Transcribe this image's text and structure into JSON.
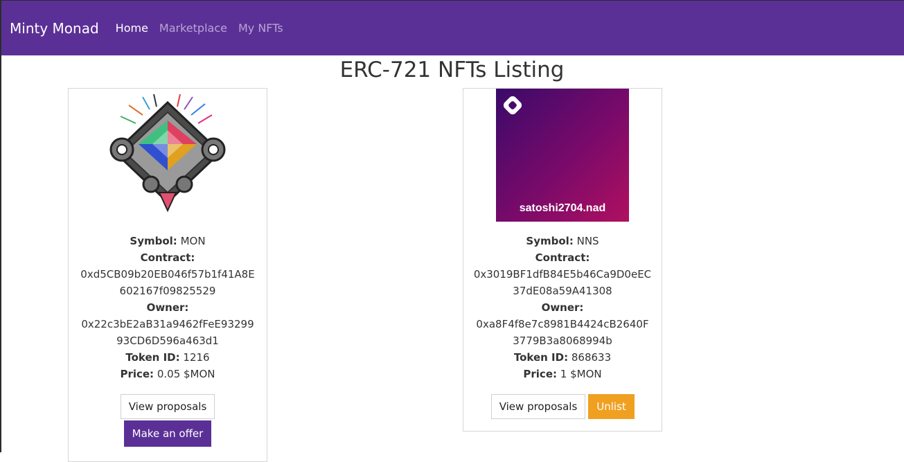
{
  "nav": {
    "brand": "Minty Monad",
    "links": [
      "Home",
      "Marketplace",
      "My NFTs"
    ]
  },
  "page_title": "ERC-721 NFTs Listing",
  "labels": {
    "symbol": "Symbol:",
    "contract": "Contract:",
    "owner": "Owner:",
    "token_id": "Token ID:",
    "price": "Price:"
  },
  "cards": [
    {
      "symbol": "MON",
      "contract": "0xd5CB09b20EB046f57b1f41A8E602167f09825529",
      "owner": "0x22c3bE2aB31a9462fFeE9329993CD6D596a463d1",
      "token_id": "1216",
      "price": "0.05 $MON",
      "buttons": [
        "View proposals",
        "Make an offer"
      ]
    },
    {
      "symbol": "NNS",
      "image_text": "satoshi2704.nad",
      "contract": "0x3019BF1dfB84E5b46Ca9D0eEC37dE08a59A41308",
      "owner": "0xa8F4f8e7c8981B4424cB2640F3779B3a8068994b",
      "token_id": "868633",
      "price": "1 $MON",
      "buttons": [
        "View proposals",
        "Unlist"
      ]
    }
  ],
  "colors": {
    "navbar": "#5b3096",
    "primary_button": "#5b3096",
    "warning_button": "#f0a020"
  }
}
